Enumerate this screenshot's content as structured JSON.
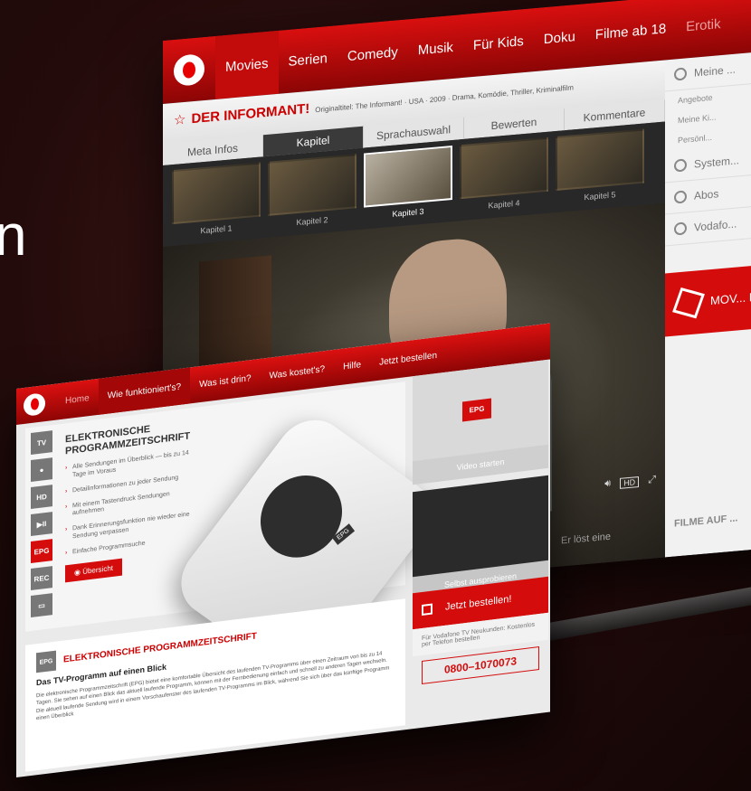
{
  "backdrop_letter": "n",
  "tv": {
    "nav": [
      "Movies",
      "Serien",
      "Comedy",
      "Musik",
      "Für Kids",
      "Doku",
      "Filme ab 18",
      "Erotik"
    ],
    "title": "DER INFORMANT!",
    "meta": "Originaltitel: The Informant! · USA · 2009 · Drama, Komödie, Thriller, Kriminalfilm",
    "tabs": [
      "Meta Infos",
      "Kapitel",
      "Sprachauswahl",
      "Bewerten",
      "Kommentare"
    ],
    "chapters": [
      "Kapitel 1",
      "Kapitel 2",
      "Kapitel 3",
      "Kapitel 4",
      "Kapitel 5"
    ],
    "selected_chapter": "Kapitel 3",
    "caption": "Er löst eine",
    "hd_label": "HD",
    "side": {
      "profile": "Meine ...",
      "sub": [
        "Angebote",
        "Meine Ki...",
        "Persönl..."
      ],
      "items": [
        "System...",
        "Abos",
        "Vodafo..."
      ],
      "promo": "MOV... Pak...",
      "footer": "FILME AUF ..."
    }
  },
  "site": {
    "nav": [
      "Home",
      "Wie funktioniert's?",
      "Was ist drin?",
      "Was kostet's?",
      "Hilfe",
      "Jetzt bestellen"
    ],
    "iconbar": [
      "TV",
      "",
      "HD",
      "▶II",
      "EPG",
      "REC",
      ""
    ],
    "heading": "ELEKTRONISCHE PROGRAMMZEITSCHRIFT",
    "bullets": [
      "Alle Sendungen im Überblick — bis zu 14 Tage im Voraus",
      "Detailinformationen zu jeder Sendung",
      "Mit einem Tastendruck Sendungen aufnehmen",
      "Dank Erinnerungsfunktion nie wieder eine Sendung verpassen",
      "Einfache Programmsuche"
    ],
    "overview_btn": "Übersicht",
    "remote_epg": "EPG",
    "remote_exit": "EXIT",
    "video_caption": "Video starten",
    "try_caption": "Selbst ausprobieren",
    "bottom_icon": "EPG",
    "bottom_title": "ELEKTRONISCHE PROGRAMMZEITSCHRIFT",
    "bottom_subtitle": "Das TV-Programm auf einen Blick",
    "bottom_text": "Die elektronische Programmzeitschrift (EPG) bietet eine komfortable Übersicht des laufenden TV-Programms über einen Zeitraum von bis zu 14 Tagen. Sie sehen auf einen Blick das aktuell laufende Programm, können mit der Fernbedienung einfach und schnell zu anderen Tagen wechseln. Die aktuell laufende Sendung wird in einem Vorschaufenster des laufenden TV-Programms im Blick, während Sie sich über das künftige Programm einen Überblick",
    "order_title": "Jetzt bestellen!",
    "order_text": "Für Vodafone TV Neukunden: Kostenlos per Telefon bestellen",
    "order_phone": "0800–1070073"
  }
}
